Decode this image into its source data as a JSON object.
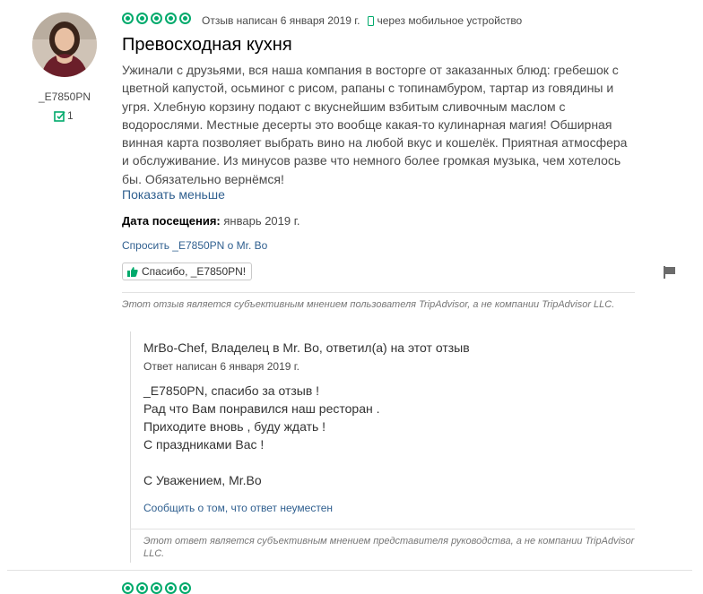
{
  "review": {
    "username": "_E7850PN",
    "contributions": "1",
    "rating": 5,
    "written_date": "Отзыв написан 6 января 2019 г.",
    "device": "через мобильное устройство",
    "title": "Превосходная кухня",
    "text": "Ужинали с друзьями, вся наша компания в восторге от заказанных блюд: гребешок с цветной капустой, осьминог с рисом, рапаны с топинамбуром, тартар из говядины и угря. Хлебную корзину подают с вкуснейшим взбитым сливочным маслом с водорослями. Местные десерты это вообще какая-то кулинарная магия! Обширная винная карта позволяет выбрать вино на любой вкус и кошелёк. Приятная атмосфера и обслуживание. Из минусов разве что немного более громкая музыка, чем хотелось бы. Обязательно вернёмся!",
    "show_less": "Показать меньше",
    "visit_label": "Дата посещения:",
    "visit_value": "январь 2019 г.",
    "ask_link": "Спросить _E7850PN о Mr. Bo",
    "thanks_button": "Спасибо, _E7850PN!",
    "disclaimer": "Этот отзыв является субъективным мнением пользователя TripAdvisor, а не компании TripAdvisor LLC."
  },
  "response": {
    "author": "MrBo-Chef, Владелец в Mr. Bo, ответил(а) на этот отзыв",
    "date": "Ответ написан 6 января 2019 г.",
    "lines": [
      "_E7850PN, спасибо за отзыв !",
      "Рад что Вам понравился наш ресторан .",
      "Приходите вновь , буду ждать !",
      "С праздниками Вас !",
      "",
      "С Уважением, Mr.Bo"
    ],
    "report_link": "Сообщить о том, что ответ неуместен",
    "disclaimer": "Этот ответ является субъективным мнением представителя руководства, а не компании TripAdvisor LLC."
  },
  "colors": {
    "accent_green": "#00aa6c",
    "link_blue": "#2f5f8f"
  },
  "icons": [
    "user-avatar",
    "contribution-icon",
    "rating-bubble",
    "mobile-phone-icon",
    "thumbs-up-icon",
    "flag-icon"
  ]
}
